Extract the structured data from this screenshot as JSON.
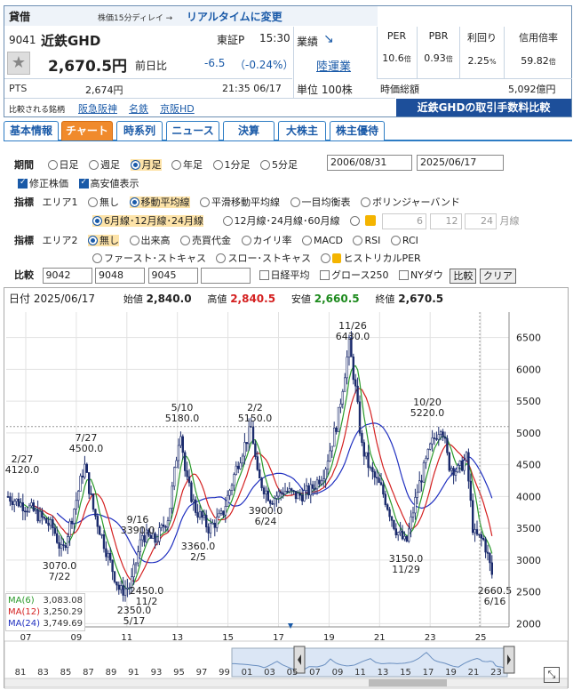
{
  "header": {
    "tag": "貸借",
    "delay_note": "株価15分ディレイ →",
    "realtime_link": "リアルタイムに変更",
    "code": "9041",
    "name": "近鉄GHD",
    "market": "東証P",
    "time": "15:30",
    "price": "2,670.5円",
    "prev_label": "前日比",
    "change": "-6.5",
    "change_pct": "（-0.24%）",
    "pts_label": "PTS",
    "pts_price": "2,674円",
    "pts_time": "21:35 06/17",
    "compare_label": "比較される銘柄",
    "compare_items": [
      "阪急阪神",
      "名鉄",
      "京阪HD"
    ],
    "gyoseki_label": "業績",
    "sector": "陸運業",
    "unit": "単位 100株",
    "market_cap_label": "時価総額",
    "market_cap": "5,092億円",
    "fee_link": "近鉄GHDの取引手数料比較"
  },
  "metrics": [
    {
      "label": "PER",
      "value": "10.6",
      "unit": "倍"
    },
    {
      "label": "PBR",
      "value": "0.93",
      "unit": "倍"
    },
    {
      "label": "利回り",
      "value": "2.25",
      "unit": "%"
    },
    {
      "label": "信用倍率",
      "value": "59.82",
      "unit": "倍"
    }
  ],
  "tabs": [
    "基本情報",
    "チャート",
    "時系列",
    "ニュース",
    "決算",
    "大株主",
    "株主優待"
  ],
  "controls": {
    "period_label": "期間",
    "periods": [
      "日足",
      "週足",
      "月足",
      "年足",
      "1分足",
      "5分足"
    ],
    "date_from": "2006/08/31",
    "date_to": "2025/06/17",
    "adjust_label": "修正株価",
    "hilo_label": "高安値表示",
    "ind_label": "指標",
    "area1_label": "エリア1",
    "area1_opts": [
      "無し",
      "移動平均線",
      "平滑移動平均線",
      "一目均衡表",
      "ボリンジャーバンド"
    ],
    "ma_opt1": "6月線･12月線･24月線",
    "ma_opt2": "12月線･24月線･60月線",
    "ma_c1": "6",
    "ma_c2": "12",
    "ma_c3": "24",
    "ma_unit": "月線",
    "area2_label": "エリア2",
    "area2_opts": [
      "無し",
      "出来高",
      "売買代金",
      "カイリ率",
      "MACD",
      "RSI",
      "RCI"
    ],
    "area2_opts2": [
      "ファースト･ストキャス",
      "スロー･ストキャス",
      "ヒストリカルPER"
    ],
    "cmp_label": "比較",
    "cmp1": "9042",
    "cmp2": "9048",
    "cmp3": "9045",
    "cmp4": "",
    "nikkei": "日経平均",
    "growth": "グロース250",
    "nydow": "NYダウ",
    "cmp_btn": "比較",
    "clear_btn": "クリア"
  },
  "chart_head": {
    "date_label": "日付",
    "date": "2025/06/17",
    "open_label": "始値",
    "open": "2,840.0",
    "high_label": "高値",
    "high": "2,840.5",
    "low_label": "安値",
    "low": "2,660.5",
    "close_label": "終値",
    "close": "2,670.5"
  },
  "legend": [
    {
      "name": "MA(6)",
      "value": "3,083.08",
      "color": "#2a9a2a"
    },
    {
      "name": "MA(12)",
      "value": "3,250.29",
      "color": "#d42020"
    },
    {
      "name": "MA(24)",
      "value": "3,749.69",
      "color": "#2030c0"
    }
  ],
  "chart_data": {
    "type": "candlestick",
    "y_ticks": [
      "6500",
      "6000",
      "5500",
      "5000",
      "4500",
      "4000",
      "3500",
      "3000",
      "2500",
      "2000"
    ],
    "x_ticks": [
      "07",
      "09",
      "11",
      "13",
      "15",
      "17",
      "19",
      "21",
      "23",
      "25"
    ],
    "annotations": [
      {
        "top": "2/27",
        "bottom": "4120.0"
      },
      {
        "top": "7/27",
        "bottom": "4500.0"
      },
      {
        "top": "3070.0",
        "bottom": "7/22"
      },
      {
        "top": "9/16",
        "bottom": "3390.0"
      },
      {
        "top": "2350.0",
        "bottom": "5/17"
      },
      {
        "top": "2450.0",
        "bottom": "11/2"
      },
      {
        "top": "5/10",
        "bottom": "5180.0"
      },
      {
        "top": "3360.0",
        "bottom": "2/5"
      },
      {
        "top": "2/2",
        "bottom": "5150.0"
      },
      {
        "top": "3900.0",
        "bottom": "6/24"
      },
      {
        "top": "11/26",
        "bottom": "6430.0"
      },
      {
        "top": "10/20",
        "bottom": "5220.0"
      },
      {
        "top": "3150.0",
        "bottom": "11/29"
      },
      {
        "top": "2660.5",
        "bottom": "6/16"
      }
    ]
  },
  "navigator": {
    "years": [
      "81",
      "83",
      "85",
      "87",
      "89",
      "91",
      "93",
      "95",
      "97",
      "99",
      "01",
      "03",
      "05",
      "07",
      "09",
      "11",
      "13",
      "15",
      "17",
      "19",
      "21",
      "23"
    ]
  }
}
